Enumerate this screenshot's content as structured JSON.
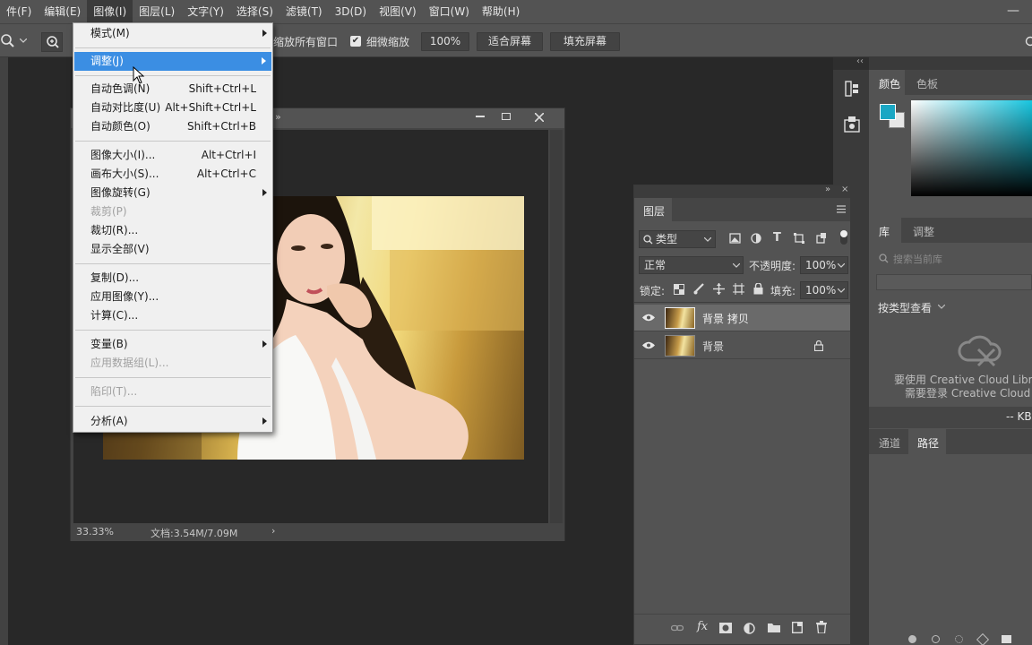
{
  "menubar": {
    "items": [
      "件(F)",
      "编辑(E)",
      "图像(I)",
      "图层(L)",
      "文字(Y)",
      "选择(S)",
      "滤镜(T)",
      "3D(D)",
      "视图(V)",
      "窗口(W)",
      "帮助(H)"
    ],
    "active_index": 2,
    "minimize_glyph": "—"
  },
  "options": {
    "zoom_all_windows": "缩放所有窗口",
    "scrubby_zoom": "细微缩放",
    "percent": "100%",
    "fit_screen": "适合屏幕",
    "fill_screen": "填充屏幕"
  },
  "menu": {
    "mode": "模式(M)",
    "adjust": "调整(J)",
    "auto_tone": "自动色调(N)",
    "auto_tone_sc": "Shift+Ctrl+L",
    "auto_contrast": "自动对比度(U)",
    "auto_contrast_sc": "Alt+Shift+Ctrl+L",
    "auto_color": "自动颜色(O)",
    "auto_color_sc": "Shift+Ctrl+B",
    "image_size": "图像大小(I)...",
    "image_size_sc": "Alt+Ctrl+I",
    "canvas_size": "画布大小(S)...",
    "canvas_size_sc": "Alt+Ctrl+C",
    "image_rotation": "图像旋转(G)",
    "crop": "裁剪(P)",
    "trim": "裁切(R)...",
    "reveal_all": "显示全部(V)",
    "duplicate": "复制(D)...",
    "apply_image": "应用图像(Y)...",
    "calculations": "计算(C)...",
    "variables": "变量(B)",
    "apply_data_set": "应用数据组(L)...",
    "trap": "陷印(T)...",
    "analysis": "分析(A)"
  },
  "document": {
    "zoom": "33.33%",
    "doc_info": "文档:3.54M/7.09M",
    "status_arrow": "›"
  },
  "layers": {
    "tab": "图层",
    "filter_kind": "类型",
    "blend_mode": "正常",
    "opacity_label": "不透明度:",
    "opacity": "100%",
    "lock_label": "锁定:",
    "fill_label": "填充:",
    "fill": "100%",
    "items": [
      {
        "name": "背景 拷贝",
        "selected": true,
        "locked": false
      },
      {
        "name": "背景",
        "selected": false,
        "locked": true
      }
    ]
  },
  "color_panel": {
    "tabs": [
      "颜色",
      "色板"
    ],
    "fg_color": "#1aa7c4",
    "bg_color": "#e6e6e6",
    "hue_color": "#18c6e0"
  },
  "libraries": {
    "tabs": [
      "库",
      "调整"
    ],
    "search_placeholder": "搜索当前库",
    "view_by": "按类型查看",
    "msg1": "要使用 Creative Cloud Librari",
    "msg2": "需要登录 Creative Cloud 帐",
    "kb": "-- KB"
  },
  "paths_panel": {
    "tabs": [
      "通道",
      "路径"
    ]
  }
}
